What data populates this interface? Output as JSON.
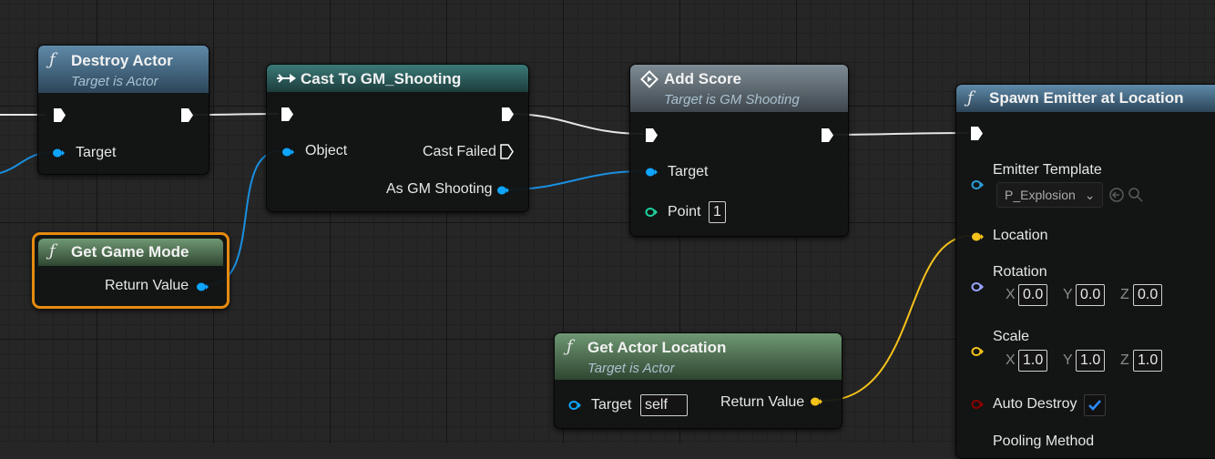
{
  "nodes": {
    "destroy_actor": {
      "title": "Destroy Actor",
      "subtitle": "Target is Actor",
      "icon": "function-icon",
      "pins": {
        "target": "Target"
      }
    },
    "cast_to": {
      "title": "Cast To GM_Shooting",
      "icon": "cast-icon",
      "pins": {
        "object": "Object",
        "cast_failed": "Cast Failed",
        "as_gm": "As GM Shooting"
      }
    },
    "add_score": {
      "title": "Add Score",
      "subtitle": "Target is GM Shooting",
      "icon": "event-icon",
      "pins": {
        "target": "Target",
        "point": "Point"
      },
      "point_value": "1"
    },
    "get_game_mode": {
      "title": "Get Game Mode",
      "icon": "function-icon",
      "pins": {
        "return_value": "Return Value"
      }
    },
    "get_actor_location": {
      "title": "Get Actor Location",
      "subtitle": "Target is Actor",
      "icon": "function-icon",
      "pins": {
        "target": "Target",
        "return_value": "Return Value"
      },
      "target_value": "self"
    },
    "spawn_emitter": {
      "title": "Spawn Emitter at Location",
      "icon": "function-icon",
      "pins": {
        "emitter_template": "Emitter Template",
        "location": "Location",
        "rotation": "Rotation",
        "scale": "Scale",
        "auto_destroy": "Auto Destroy",
        "pooling_method": "Pooling Method"
      },
      "emitter_value": "P_Explosion",
      "rotation": {
        "x_label": "X",
        "x": "0.0",
        "y_label": "Y",
        "y": "0.0",
        "z_label": "Z",
        "z": "0.0"
      },
      "scale": {
        "x_label": "X",
        "x": "1.0",
        "y_label": "Y",
        "y": "1.0",
        "z_label": "Z",
        "z": "1.0"
      },
      "auto_destroy_checked": true
    }
  },
  "colors": {
    "exec": "#ffffff",
    "object_pin": "#0ea5ff",
    "vector_pin": "#f5c21a",
    "rotator_pin": "#9aa4ff",
    "bool_pin": "#8b0000",
    "particle_pin": "#2a9fd6",
    "int_pin": "#1fd1a0",
    "selection": "#e58b10"
  }
}
